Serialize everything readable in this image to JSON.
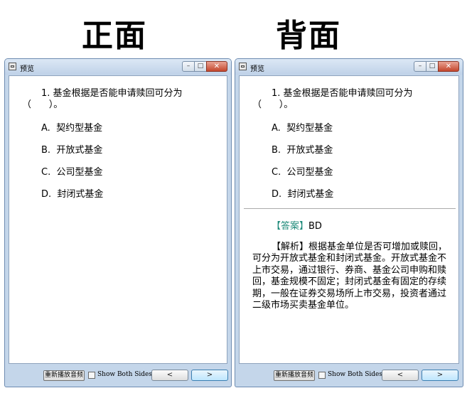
{
  "headings": {
    "front": "正面",
    "back": "背面"
  },
  "window": {
    "title": "预览",
    "controls": {
      "minimize": "–",
      "maximize": "□",
      "close": "✕"
    }
  },
  "question": {
    "number_text": "1.  基金根据是否能申请赎回可分为",
    "paren": "（      ）。",
    "options": [
      {
        "letter": "A.",
        "text": "契约型基金"
      },
      {
        "letter": "B.",
        "text": "开放式基金"
      },
      {
        "letter": "C.",
        "text": "公司型基金"
      },
      {
        "letter": "D.",
        "text": "封闭式基金"
      }
    ]
  },
  "answer": {
    "label": "【答案】",
    "value": "BD",
    "analysis_label": "【解析】",
    "analysis_text": "根据基金单位是否可增加或赎回，可分为开放式基金和封闭式基金。开放式基金不上市交易，通过银行、券商、基金公司申购和赎回，基金规模不固定；封闭式基金有固定的存续期，一般在证券交易场所上市交易，投资者通过二级市场买卖基金单位。"
  },
  "toolbar": {
    "replay_label": "重新播放音频",
    "show_both_label": "Show Both Sides",
    "prev": "<",
    "next": ">"
  },
  "colors": {
    "accent": "#1e8a7a",
    "window_frame": "#c4d6ea"
  }
}
